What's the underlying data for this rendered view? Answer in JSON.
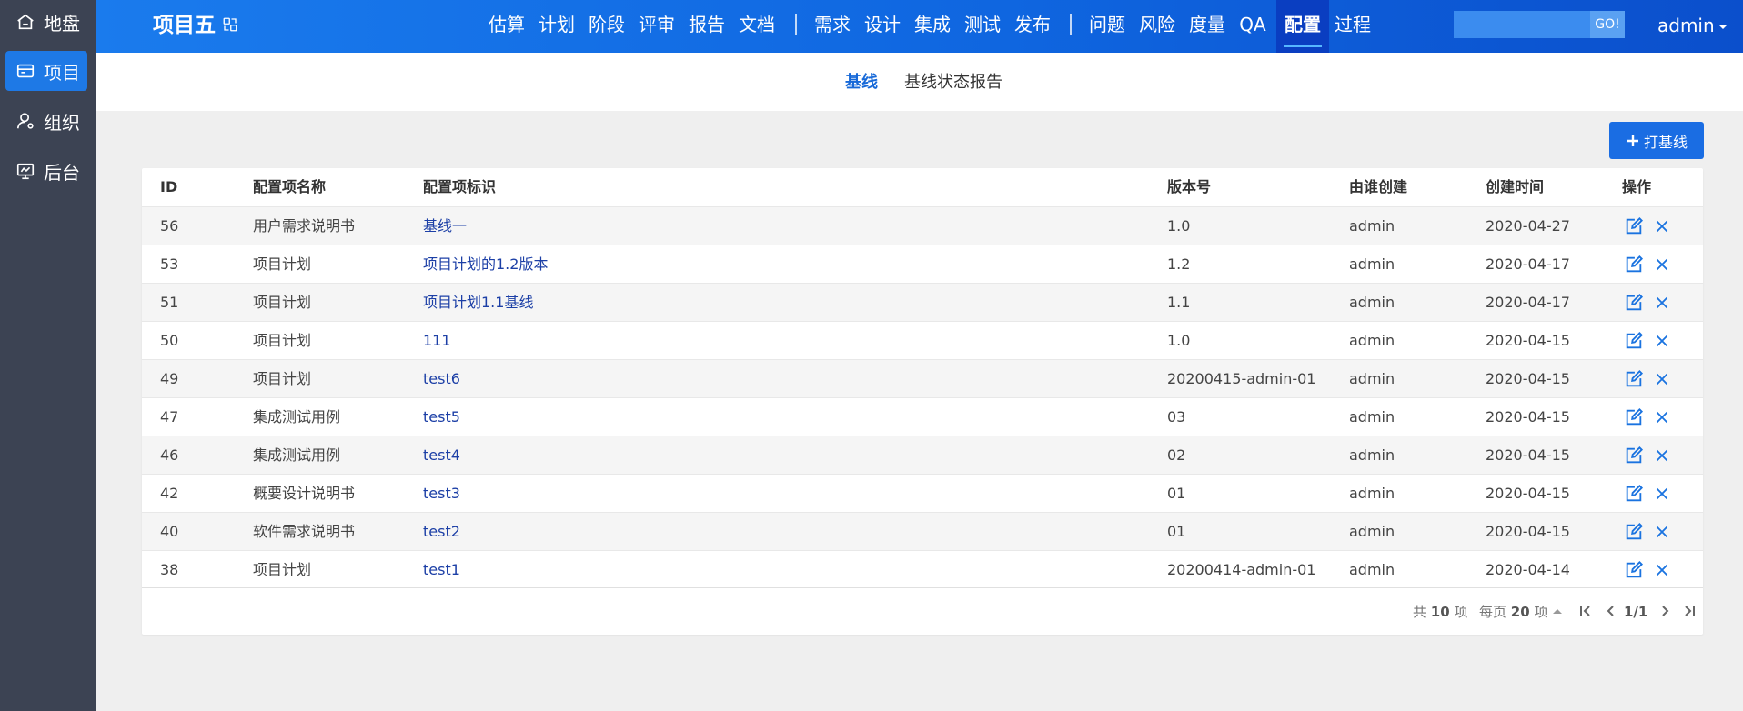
{
  "sidebar": {
    "items": [
      {
        "label": "地盘",
        "icon": "home-icon",
        "active": false
      },
      {
        "label": "项目",
        "icon": "project-icon",
        "active": true
      },
      {
        "label": "组织",
        "icon": "user-icon",
        "active": false
      },
      {
        "label": "后台",
        "icon": "monitor-icon",
        "active": false
      }
    ]
  },
  "header": {
    "project_title": "项目五",
    "nav": [
      "估算",
      "计划",
      "阶段",
      "评审",
      "报告",
      "文档",
      "需求",
      "设计",
      "集成",
      "测试",
      "发布",
      "问题",
      "风险",
      "度量",
      "QA",
      "配置",
      "过程"
    ],
    "active_nav": "配置",
    "search_placeholder": "",
    "search_button": "GO!",
    "user": "admin"
  },
  "subnav": {
    "tabs": [
      "基线",
      "基线状态报告"
    ],
    "active": "基线"
  },
  "actions": {
    "create_baseline": "打基线"
  },
  "table": {
    "columns": [
      "ID",
      "配置项名称",
      "配置项标识",
      "版本号",
      "由谁创建",
      "创建时间",
      "操作"
    ],
    "rows": [
      {
        "id": "56",
        "name": "用户需求说明书",
        "identifier": "基线一",
        "version": "1.0",
        "creator": "admin",
        "created": "2020-04-27"
      },
      {
        "id": "53",
        "name": "项目计划",
        "identifier": "项目计划的1.2版本",
        "version": "1.2",
        "creator": "admin",
        "created": "2020-04-17"
      },
      {
        "id": "51",
        "name": "项目计划",
        "identifier": "项目计划1.1基线",
        "version": "1.1",
        "creator": "admin",
        "created": "2020-04-17"
      },
      {
        "id": "50",
        "name": "项目计划",
        "identifier": "111",
        "version": "1.0",
        "creator": "admin",
        "created": "2020-04-15"
      },
      {
        "id": "49",
        "name": "项目计划",
        "identifier": "test6",
        "version": "20200415-admin-01",
        "creator": "admin",
        "created": "2020-04-15"
      },
      {
        "id": "47",
        "name": "集成测试用例",
        "identifier": "test5",
        "version": "03",
        "creator": "admin",
        "created": "2020-04-15"
      },
      {
        "id": "46",
        "name": "集成测试用例",
        "identifier": "test4",
        "version": "02",
        "creator": "admin",
        "created": "2020-04-15"
      },
      {
        "id": "42",
        "name": "概要设计说明书",
        "identifier": "test3",
        "version": "01",
        "creator": "admin",
        "created": "2020-04-15"
      },
      {
        "id": "40",
        "name": "软件需求说明书",
        "identifier": "test2",
        "version": "01",
        "creator": "admin",
        "created": "2020-04-15"
      },
      {
        "id": "38",
        "name": "项目计划",
        "identifier": "test1",
        "version": "20200414-admin-01",
        "creator": "admin",
        "created": "2020-04-14"
      }
    ],
    "row_action_icons": [
      "edit-icon",
      "delete-icon"
    ]
  },
  "pager": {
    "total_prefix": "共",
    "total": "10",
    "total_suffix": "项",
    "per_page_prefix": "每页",
    "per_page": "20",
    "per_page_suffix": "项",
    "page": "1/1"
  },
  "colors": {
    "sidebar_bg": "#3c4353",
    "sidebar_active": "#1e79e6",
    "header_start": "#1a7bed",
    "header_end": "#0b4fcc",
    "link": "#1c3fa6",
    "primary": "#1a6de3"
  }
}
